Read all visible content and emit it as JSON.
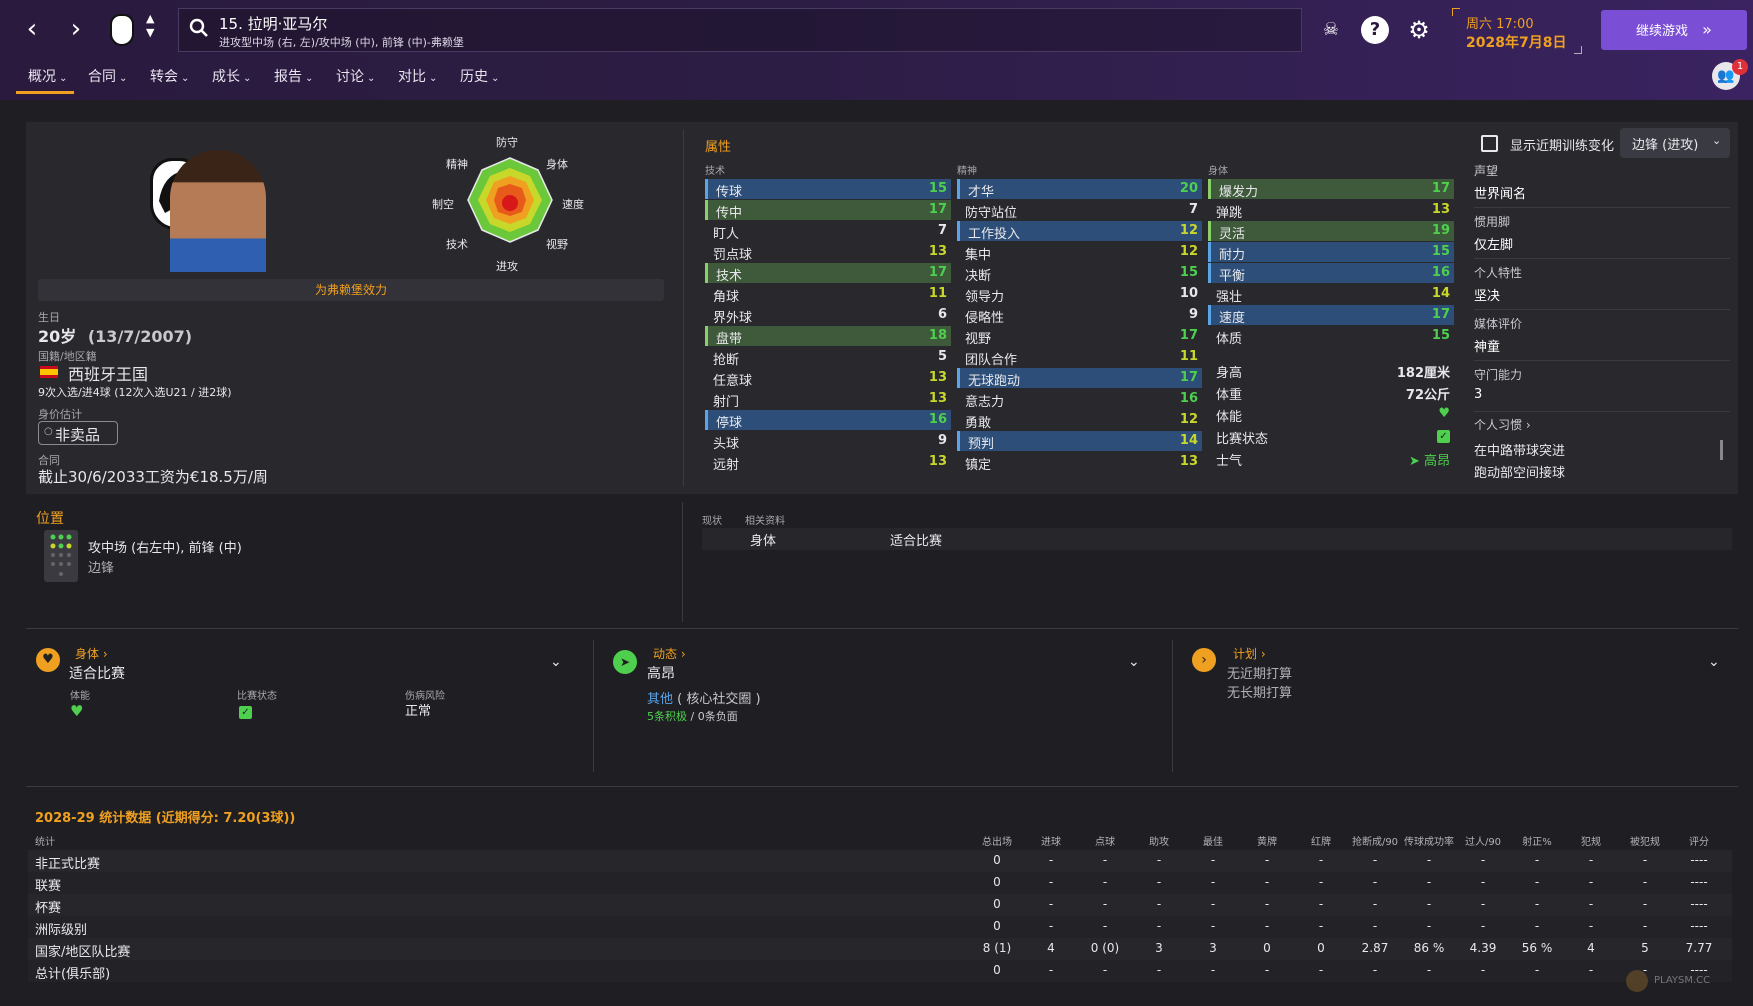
{
  "header": {
    "player_title": "15. 拉明·亚马尔",
    "player_subtitle": "进攻型中场 (右, 左)/攻中场 (中), 前锋 (中)-弗赖堡",
    "date_day": "周六 17:00",
    "date_full": "2028年7月8日",
    "continue_label": "继续游戏",
    "notification_count": "1"
  },
  "tabs": [
    {
      "label": "概况"
    },
    {
      "label": "合同"
    },
    {
      "label": "转会"
    },
    {
      "label": "成长"
    },
    {
      "label": "报告"
    },
    {
      "label": "讨论"
    },
    {
      "label": "对比"
    },
    {
      "label": "历史"
    }
  ],
  "profile": {
    "playing_for": "为弗赖堡效力",
    "birth_label": "生日",
    "birth_value": "20岁",
    "birth_date": "(13/7/2007)",
    "nation_label": "国籍/地区籍",
    "nation_value": "西班牙王国",
    "caps": "9次入选/进4球 (12次入选U21 / 进2球)",
    "value_label": "身价估计",
    "value_value": "非卖品",
    "contract_label": "合同",
    "contract_value": "截止30/6/2033工资为€18.5万/周"
  },
  "radar": {
    "labels": {
      "top": "防守",
      "top_right": "身体",
      "right": "速度",
      "bottom_right": "视野",
      "bottom": "进攻",
      "bottom_left": "技术",
      "left": "制空",
      "top_left": "精神"
    }
  },
  "attributes": {
    "title": "属性",
    "technical_label": "技术",
    "mental_label": "精神",
    "physical_label": "身体",
    "technical": [
      {
        "name": "传球",
        "value": "15",
        "hl": "blue"
      },
      {
        "name": "传中",
        "value": "17",
        "hl": "green"
      },
      {
        "name": "盯人",
        "value": "7",
        "hl": ""
      },
      {
        "name": "罚点球",
        "value": "13",
        "hl": ""
      },
      {
        "name": "技术",
        "value": "17",
        "hl": "green"
      },
      {
        "name": "角球",
        "value": "11",
        "hl": ""
      },
      {
        "name": "界外球",
        "value": "6",
        "hl": ""
      },
      {
        "name": "盘带",
        "value": "18",
        "hl": "green"
      },
      {
        "name": "抢断",
        "value": "5",
        "hl": ""
      },
      {
        "name": "任意球",
        "value": "13",
        "hl": ""
      },
      {
        "name": "射门",
        "value": "13",
        "hl": ""
      },
      {
        "name": "停球",
        "value": "16",
        "hl": "blue"
      },
      {
        "name": "头球",
        "value": "9",
        "hl": ""
      },
      {
        "name": "远射",
        "value": "13",
        "hl": ""
      }
    ],
    "mental": [
      {
        "name": "才华",
        "value": "20",
        "hl": "blue"
      },
      {
        "name": "防守站位",
        "value": "7",
        "hl": ""
      },
      {
        "name": "工作投入",
        "value": "12",
        "hl": "blue"
      },
      {
        "name": "集中",
        "value": "12",
        "hl": ""
      },
      {
        "name": "决断",
        "value": "15",
        "hl": ""
      },
      {
        "name": "领导力",
        "value": "10",
        "hl": ""
      },
      {
        "name": "侵略性",
        "value": "9",
        "hl": ""
      },
      {
        "name": "视野",
        "value": "17",
        "hl": ""
      },
      {
        "name": "团队合作",
        "value": "11",
        "hl": ""
      },
      {
        "name": "无球跑动",
        "value": "17",
        "hl": "blue"
      },
      {
        "name": "意志力",
        "value": "16",
        "hl": ""
      },
      {
        "name": "勇敢",
        "value": "12",
        "hl": ""
      },
      {
        "name": "预判",
        "value": "14",
        "hl": "blue"
      },
      {
        "name": "镇定",
        "value": "13",
        "hl": ""
      }
    ],
    "physical": [
      {
        "name": "爆发力",
        "value": "17",
        "hl": "green"
      },
      {
        "name": "弹跳",
        "value": "13",
        "hl": ""
      },
      {
        "name": "灵活",
        "value": "19",
        "hl": "green"
      },
      {
        "name": "耐力",
        "value": "15",
        "hl": "blue"
      },
      {
        "name": "平衡",
        "value": "16",
        "hl": "blue"
      },
      {
        "name": "强壮",
        "value": "14",
        "hl": ""
      },
      {
        "name": "速度",
        "value": "17",
        "hl": "blue"
      },
      {
        "name": "体质",
        "value": "15",
        "hl": ""
      }
    ],
    "body": [
      {
        "name": "身高",
        "value": "182厘米"
      },
      {
        "name": "体重",
        "value": "72公斤"
      },
      {
        "name": "体能",
        "value": ""
      },
      {
        "name": "比赛状态",
        "value": ""
      },
      {
        "name": "士气",
        "value": "高昂"
      }
    ]
  },
  "traits": {
    "show_training_label": "显示近期训练变化",
    "role_select": "边锋 (进攻)",
    "items": [
      {
        "title": "声望",
        "value": "世界闻名"
      },
      {
        "title": "惯用脚",
        "value": "仅左脚"
      },
      {
        "title": "个人特性",
        "value": "坚决"
      },
      {
        "title": "媒体评价",
        "value": "神童"
      },
      {
        "title": "守门能力",
        "value": "3"
      }
    ],
    "habits_title": "个人习惯",
    "habits": [
      "在中路带球突进",
      "跑动部空间接球"
    ]
  },
  "position": {
    "title": "位置",
    "main": "攻中场 (右左中), 前锋 (中)",
    "secondary": "边锋"
  },
  "status_panel": {
    "tab1": "现状",
    "tab2": "相关资料",
    "col1": "身体",
    "col2": "适合比赛"
  },
  "cards": {
    "physical": {
      "title": "身体",
      "value": "适合比赛",
      "fitness_label": "体能",
      "form_label": "比赛状态",
      "injury_label": "伤病风险",
      "injury_value": "正常"
    },
    "dynamics": {
      "title": "动态",
      "value": "高昂",
      "group_link": "其他",
      "group_text": "( 核心社交圈 )",
      "positive": "5条积极",
      "negative": "/ 0条负面"
    },
    "plans": {
      "title": "计划",
      "line1": "无近期打算",
      "line2": "无长期打算"
    }
  },
  "stats": {
    "title": "2028-29 统计数据 (近期得分: 7.20(3球))",
    "col_label": "统计",
    "columns": [
      "总出场",
      "进球",
      "点球",
      "助攻",
      "最佳",
      "黄牌",
      "红牌",
      "抢断成/90",
      "传球成功率",
      "过人/90",
      "射正%",
      "犯规",
      "被犯规",
      "评分"
    ],
    "rows": [
      {
        "label": "非正式比赛",
        "cells": [
          "0",
          "-",
          "-",
          "-",
          "-",
          "-",
          "-",
          "-",
          "-",
          "-",
          "-",
          "-",
          "-",
          "----"
        ]
      },
      {
        "label": "联赛",
        "cells": [
          "0",
          "-",
          "-",
          "-",
          "-",
          "-",
          "-",
          "-",
          "-",
          "-",
          "-",
          "-",
          "-",
          "----"
        ]
      },
      {
        "label": "杯赛",
        "cells": [
          "0",
          "-",
          "-",
          "-",
          "-",
          "-",
          "-",
          "-",
          "-",
          "-",
          "-",
          "-",
          "-",
          "----"
        ]
      },
      {
        "label": "洲际级别",
        "cells": [
          "0",
          "-",
          "-",
          "-",
          "-",
          "-",
          "-",
          "-",
          "-",
          "-",
          "-",
          "-",
          "-",
          "----"
        ]
      },
      {
        "label": "国家/地区队比赛",
        "cells": [
          "8 (1)",
          "4",
          "0 (0)",
          "3",
          "3",
          "0",
          "0",
          "2.87",
          "86 %",
          "4.39",
          "56 %",
          "4",
          "5",
          "7.77"
        ]
      },
      {
        "label": "总计(俱乐部)",
        "cells": [
          "0",
          "-",
          "-",
          "-",
          "-",
          "-",
          "-",
          "-",
          "-",
          "-",
          "-",
          "-",
          "-",
          "----"
        ]
      }
    ]
  },
  "watermark": "PLAYSM.CC",
  "colors": {
    "accent": "#f0a020",
    "button": "#7a4fd6",
    "highlight_blue": "#2c4e78",
    "highlight_green": "#3e5a3a",
    "good": "#4ed04e"
  }
}
